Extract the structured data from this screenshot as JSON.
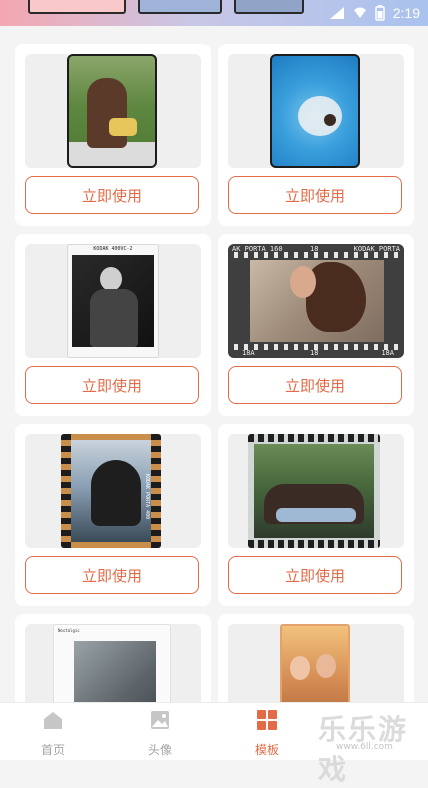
{
  "status_bar": {
    "time": "2:19",
    "battery_icon": "battery-icon",
    "signal_icon": "signal-icon",
    "wifi_icon": "wifi-icon"
  },
  "templates": [
    {
      "button_label": "立即使用"
    },
    {
      "button_label": "立即使用"
    },
    {
      "button_label": "立即使用",
      "frame_label": "KODAK 400VC-2"
    },
    {
      "button_label": "立即使用",
      "frame_label_left": "AK PORTA 160",
      "frame_label_mid": "18",
      "frame_label_right": "KODAK PORTA",
      "frame_bottom_left": "18A",
      "frame_bottom_mid": "18",
      "frame_bottom_right": "18A"
    },
    {
      "button_label": "立即使用",
      "frame_label": "KODAK PORTA 400"
    },
    {
      "button_label": "立即使用"
    },
    {
      "button_label": "",
      "frame_label": "Nostalgic"
    },
    {
      "button_label": ""
    }
  ],
  "nav": {
    "items": [
      {
        "label": "首页",
        "icon": "home-icon"
      },
      {
        "label": "头像",
        "icon": "image-icon"
      },
      {
        "label": "模板",
        "icon": "grid-icon",
        "active": true
      }
    ]
  },
  "watermark": {
    "text": "乐乐游戏",
    "url": "www.6ll.com"
  },
  "colors": {
    "accent": "#e36b47",
    "inactive": "#a4a4a4"
  }
}
